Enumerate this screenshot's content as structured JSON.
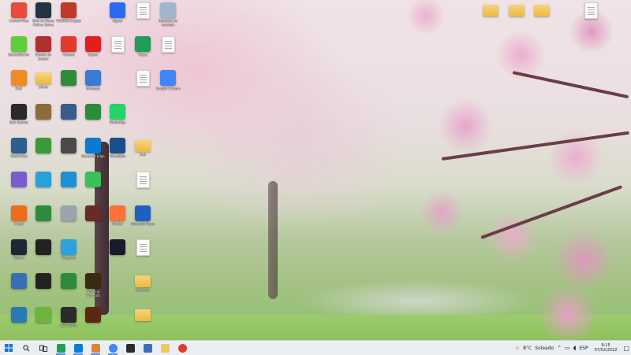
{
  "desktop": {
    "icons": [
      {
        "label": "Control Files",
        "icon": "chrome-remote-icon",
        "color": "#e74c3c"
      },
      {
        "label": "Kimi no Nawa Online Game",
        "icon": "game-icon",
        "color": "#223344"
      },
      {
        "label": "TECHNO Crypto",
        "icon": "app-icon",
        "color": "#c0392b"
      },
      {
        "label": "Signal",
        "icon": "signal-icon",
        "color": "#2c6bed"
      },
      {
        "label": "",
        "icon": "file-icon",
        "color": "#cccccc"
      },
      {
        "label": "Papelera de reciclaje",
        "icon": "recycle-bin-icon",
        "color": "#9fb6cc"
      },
      {
        "label": "BalenaEtcher",
        "icon": "etcher-icon",
        "color": "#5fce3a"
      },
      {
        "label": "Diseño de juegos",
        "icon": "game-icon",
        "color": "#b03030"
      },
      {
        "label": "Huawei",
        "icon": "huawei-icon",
        "color": "#e23b2e"
      },
      {
        "label": "Opera",
        "icon": "opera-icon",
        "color": "#e0201f"
      },
      {
        "label": "",
        "icon": "file-icon",
        "color": "#cccccc"
      },
      {
        "label": "Hojas",
        "icon": "sheets-icon",
        "color": "#1e9e57"
      },
      {
        "label": "",
        "icon": "file-icon",
        "color": "#cccccc"
      },
      {
        "label": "DeX",
        "icon": "dex-icon",
        "color": "#f08a24"
      },
      {
        "label": "Libros",
        "icon": "folder-icon",
        "color": "#f0c85a"
      },
      {
        "label": "",
        "icon": "xbox-icon",
        "color": "#2d8c3c"
      },
      {
        "label": "Inkscape",
        "icon": "app-icon",
        "color": "#3a7bd5"
      },
      {
        "label": "",
        "icon": "file-icon",
        "color": "#cccccc"
      },
      {
        "label": "Google Chrome",
        "icon": "chrome-icon",
        "color": "#4285f4"
      },
      {
        "label": "Epic Games",
        "icon": "epic-games-icon",
        "color": "#2a2a2a"
      },
      {
        "label": "",
        "icon": "game-icon",
        "color": "#8a6d3b"
      },
      {
        "label": "",
        "icon": "game-icon",
        "color": "#3b5b8a"
      },
      {
        "label": "",
        "icon": "xbox-icon",
        "color": "#2d8c3c"
      },
      {
        "label": "WhatsApp",
        "icon": "whatsapp-icon",
        "color": "#25d366"
      },
      {
        "label": "WinDirStat",
        "icon": "app-icon",
        "color": "#2e5e8e"
      },
      {
        "label": "",
        "icon": "app-icon",
        "color": "#3a9a3a"
      },
      {
        "label": "",
        "icon": "app-icon",
        "color": "#4a4a4a"
      },
      {
        "label": "Microsoft Edge",
        "icon": "edge-icon",
        "color": "#0b7bd1"
      },
      {
        "label": "VirtualBox",
        "icon": "virtualbox-icon",
        "color": "#1b4f8a"
      },
      {
        "label": "Pod",
        "icon": "folder-icon",
        "color": "#f0c85a"
      },
      {
        "label": "",
        "icon": "game-icon",
        "color": "#7a5bd0"
      },
      {
        "label": "",
        "icon": "app-icon",
        "color": "#2aa0d8"
      },
      {
        "label": "",
        "icon": "app-icon",
        "color": "#1e90d6"
      },
      {
        "label": "",
        "icon": "app-icon",
        "color": "#3dbf57"
      },
      {
        "label": "",
        "icon": "file-icon",
        "color": "#cccccc"
      },
      {
        "label": "Avast",
        "icon": "avast-icon",
        "color": "#f06a1d"
      },
      {
        "label": "",
        "icon": "xbox-icon",
        "color": "#2d8c3c"
      },
      {
        "label": "",
        "icon": "app-icon",
        "color": "#9aa4ad"
      },
      {
        "label": "",
        "icon": "game-icon",
        "color": "#6a2a2a"
      },
      {
        "label": "Firefox",
        "icon": "firefox-icon",
        "color": "#ff7139"
      },
      {
        "label": "Microsoft Store",
        "icon": "store-icon",
        "color": "#1f5fbf"
      },
      {
        "label": "Steam",
        "icon": "steam-icon",
        "color": "#1b2838"
      },
      {
        "label": "",
        "icon": "game-icon",
        "color": "#222222"
      },
      {
        "label": "Telegram",
        "icon": "telegram-icon",
        "color": "#2aa3de"
      },
      {
        "label": "",
        "icon": "app-icon",
        "color": "#1a1a2e"
      },
      {
        "label": "",
        "icon": "file-icon",
        "color": "#cccccc"
      },
      {
        "label": "",
        "icon": "app-icon",
        "color": "#3a6fb5"
      },
      {
        "label": "",
        "icon": "game-icon",
        "color": "#222222"
      },
      {
        "label": "",
        "icon": "xbox-icon",
        "color": "#2d8c3c"
      },
      {
        "label": "World of Warcraft",
        "icon": "wow-icon",
        "color": "#3a2a10"
      },
      {
        "label": "Libranos",
        "icon": "folder-icon",
        "color": "#f0c85a"
      },
      {
        "label": "",
        "icon": "game-icon",
        "color": "#2a7ab5"
      },
      {
        "label": "",
        "icon": "app-icon",
        "color": "#6db33f"
      },
      {
        "label": "OBS Studio",
        "icon": "obs-icon",
        "color": "#2b2b2b"
      },
      {
        "label": "",
        "icon": "game-icon",
        "color": "#5a2a10"
      },
      {
        "label": "",
        "icon": "folder-icon",
        "color": "#f0c85a"
      },
      {
        "label": "",
        "icon": "folder-icon",
        "color": "#f0c85a"
      },
      {
        "label": "",
        "icon": "folder-icon",
        "color": "#f0c85a"
      },
      {
        "label": "",
        "icon": "file-icon",
        "color": "#cccccc"
      },
      {
        "label": "",
        "icon": "folder-icon",
        "color": "#f0c85a"
      }
    ]
  },
  "taskbar": {
    "start_icon": "windows-start-icon",
    "search_icon": "search-icon",
    "taskview_icon": "task-view-icon",
    "apps": [
      {
        "icon": "sheets-app-icon",
        "color": "#1e9e57"
      },
      {
        "icon": "edge-app-icon",
        "color": "#0b7bd1"
      },
      {
        "icon": "paint-app-icon",
        "color": "#e0833a"
      },
      {
        "icon": "chrome-app-icon",
        "color": "#4285f4"
      },
      {
        "icon": "terminal-app-icon",
        "color": "#2b2b2b"
      },
      {
        "icon": "monitor-app-icon",
        "color": "#3a6fb5"
      },
      {
        "icon": "explorer-app-icon",
        "color": "#f0c85a"
      },
      {
        "icon": "chrome-profile-app-icon",
        "color": "#e23b2e"
      }
    ],
    "weather_temp": "8°C",
    "weather_desc": "Soleado",
    "time": "9:15",
    "date": "07/02/2022"
  }
}
